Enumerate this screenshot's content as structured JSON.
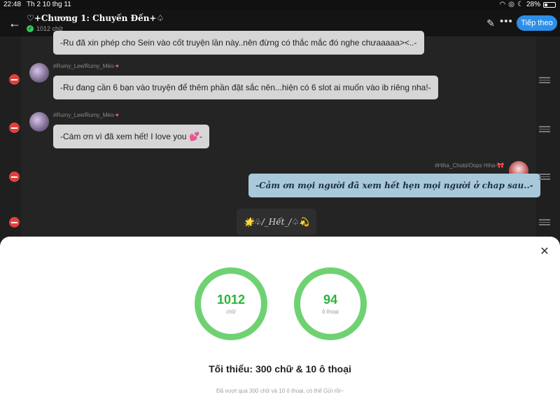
{
  "status_bar": {
    "time": "22:48",
    "date": "Th 2 10 thg 11",
    "battery": "28%",
    "battery_level": 0.28
  },
  "header": {
    "title": "♡+Chương 1: Chuyến Đến+♤",
    "word_count": "1012 chữ",
    "next_label": "Tiếp theo"
  },
  "messages": [
    {
      "author": "",
      "text": "-Ru đã xin phép cho Sein vào cốt truyện lần này..nên đừng có thắc mắc đó nghe chưaaaaa><..-"
    },
    {
      "author": "#Rumy_Lee/Rumy_Mèo-",
      "text": "-Ru đang cần 6 bạn vào truyện để thêm phần đặt sắc nên...hiện có 6 slot ai muốn vào ib riêng nha!-"
    },
    {
      "author": "#Rumy_Lee/Rumy_Mèo-",
      "text": "-Cám ơn vì đã xem hết! I love you 💕-"
    },
    {
      "author": "#Hiha_Chobi/Oops Hiha-",
      "text": "-Cảm ơn mọi người đã xem hết hẹn mọi người ở chap sau..-"
    },
    {
      "author": "",
      "text": "🌟♧/_Hết_/♤💫"
    }
  ],
  "sheet": {
    "words_value": "1012",
    "words_label": "chữ",
    "dialogue_value": "94",
    "dialogue_label": "ô thoại",
    "minimum": "Tối thiểu: 300 chữ & 10 ô thoại",
    "note": "Đã vượt quá 300 chữ và 10 ô thoại, có thể Gửi rồi~"
  },
  "colors": {
    "accent": "#2d8fe7",
    "ring": "#6fd272",
    "delete": "#e0413c"
  }
}
